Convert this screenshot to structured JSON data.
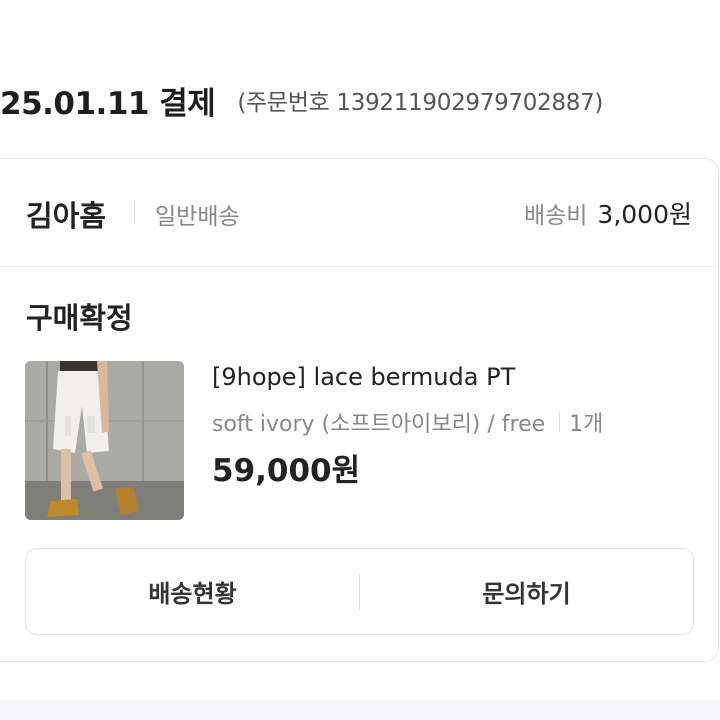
{
  "order": {
    "date_label": "25.01.11 결제",
    "order_number_text": "(주문번호 139211902979702887)"
  },
  "shop": {
    "name": "김아홈",
    "shipping_type": "일반배송",
    "shipping_fee_label": "배송비",
    "shipping_fee_value": "3,000원"
  },
  "status": "구매확정",
  "product": {
    "name": "[9hope] lace bermuda PT",
    "option": "soft ivory (소프트아이보리) / free",
    "quantity": "1개",
    "price": "59,000원",
    "image_icon": "product-photo"
  },
  "actions": {
    "delivery_status_label": "배송현황",
    "inquiry_label": "문의하기"
  }
}
